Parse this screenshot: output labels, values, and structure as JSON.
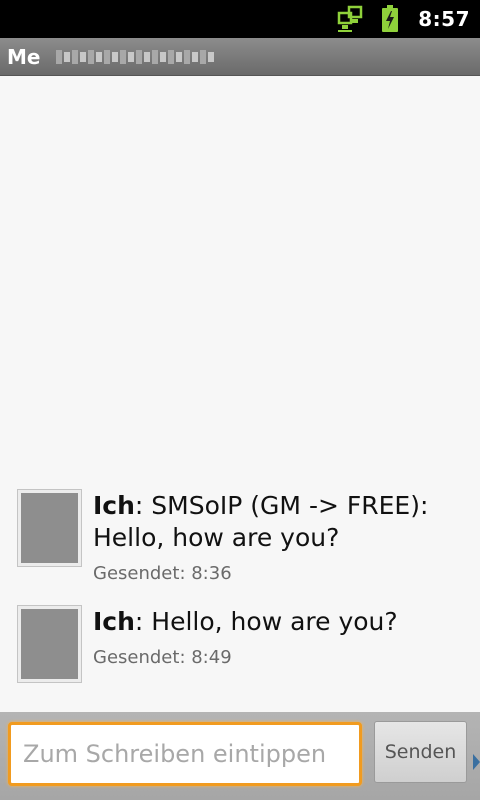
{
  "status_bar": {
    "time": "8:57",
    "icons": [
      "data-sync-icon",
      "battery-charging-icon"
    ],
    "icon_color": "#8fd13b"
  },
  "title_bar": {
    "title": "Me"
  },
  "messages": [
    {
      "sender": "Ich",
      "separator": ": ",
      "text": "SMSoIP (GM -> FREE): Hello, how are you?",
      "status": "Gesendet: 8:36"
    },
    {
      "sender": "Ich",
      "separator": ": ",
      "text": "Hello, how are you?",
      "status": "Gesendet: 8:49"
    }
  ],
  "compose": {
    "placeholder": "Zum Schreiben eintippen",
    "value": "",
    "send_label": "Senden",
    "focus_color": "#f19b1f"
  }
}
